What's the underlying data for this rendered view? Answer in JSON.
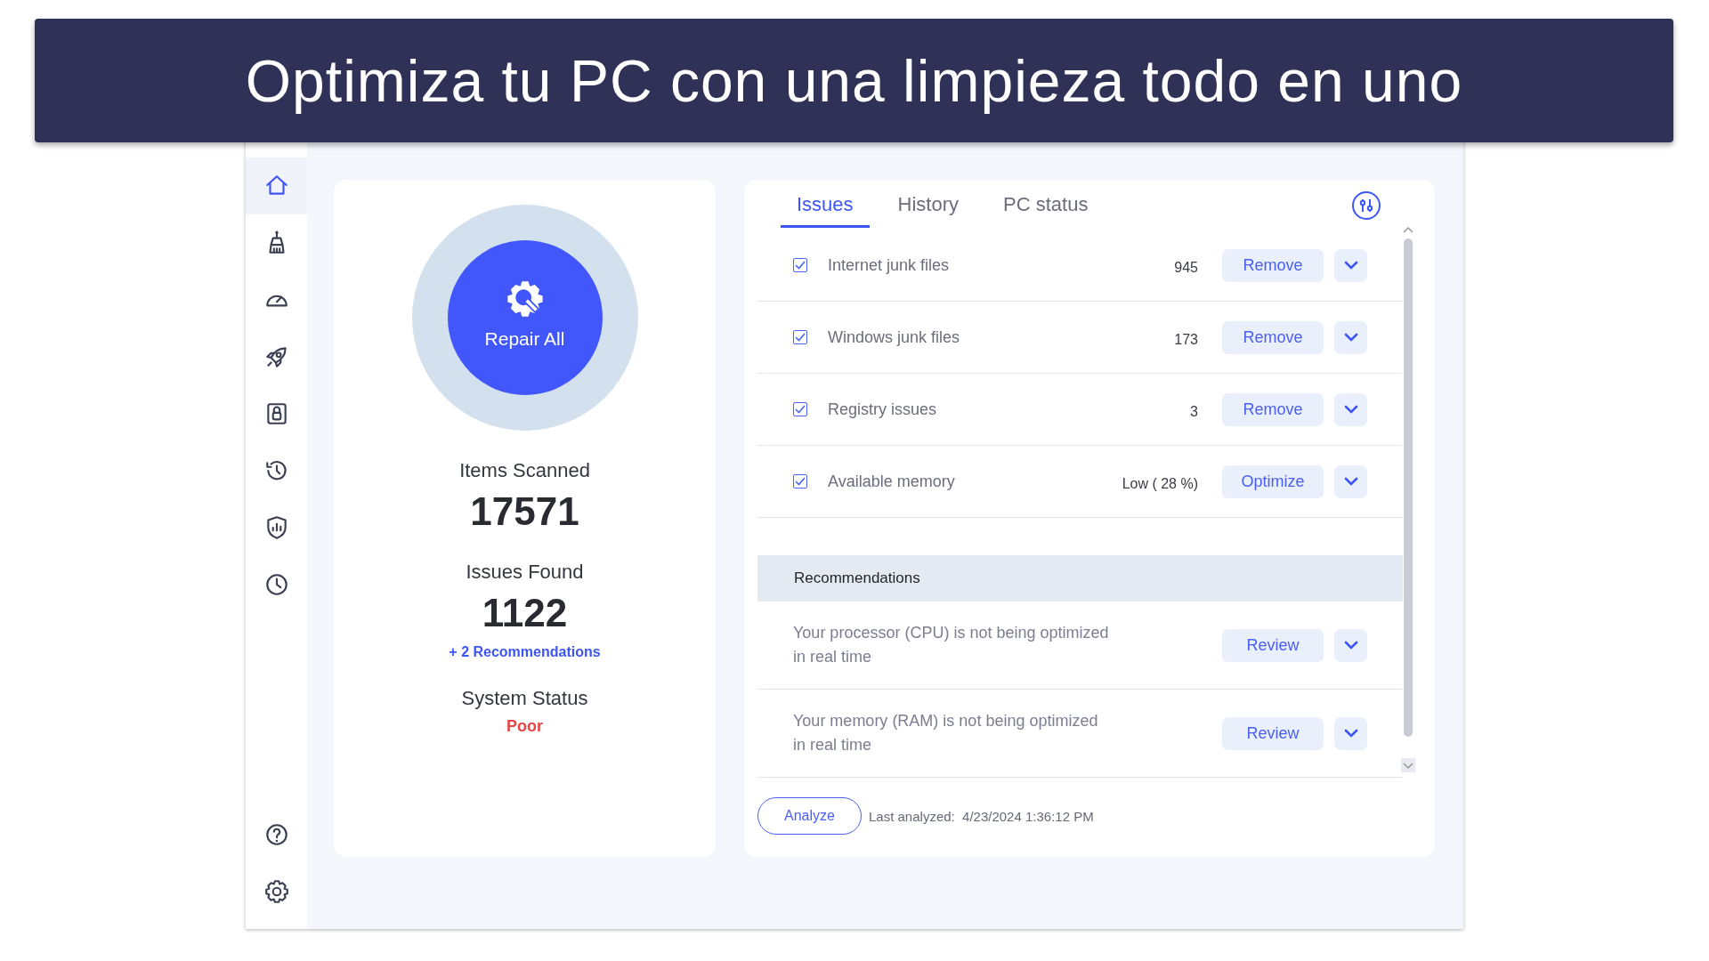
{
  "banner": {
    "title": "Optimiza tu PC con una limpieza todo en uno"
  },
  "sidebar": {
    "items": [
      {
        "selected": true
      },
      {
        "selected": false
      },
      {
        "selected": false
      },
      {
        "selected": false
      },
      {
        "selected": false
      },
      {
        "selected": false
      },
      {
        "selected": false
      },
      {
        "selected": false
      }
    ],
    "bottom_items": [
      {
        "selected": false
      },
      {
        "selected": false
      }
    ]
  },
  "summary": {
    "repair_button": "Repair All",
    "items_label": "Items Scanned",
    "items_value": "17571",
    "issues_label": "Issues Found",
    "issues_value": "1122",
    "recommendations_link": "+ 2 Recommendations",
    "status_label": "System Status",
    "status_value": "Poor"
  },
  "tabs": [
    {
      "label": "Issues",
      "selected": true
    },
    {
      "label": "History",
      "selected": false
    },
    {
      "label": "PC status",
      "selected": false
    }
  ],
  "issues": [
    {
      "label": "Internet junk files",
      "checked": true,
      "count": "945",
      "action": "Remove"
    },
    {
      "label": "Windows junk files",
      "checked": true,
      "count": "173",
      "action": "Remove"
    },
    {
      "label": "Registry issues",
      "checked": true,
      "count": "3",
      "action": "Remove"
    },
    {
      "label": "Available memory",
      "checked": true,
      "count": "Low ( 28 %)",
      "action": "Optimize"
    }
  ],
  "recommendations": {
    "title": "Recommendations",
    "items": [
      {
        "text": "Your processor (CPU) is not being optimized in real time",
        "action": "Review"
      },
      {
        "text": "Your memory (RAM) is not being optimized in real time",
        "action": "Review"
      }
    ]
  },
  "footer": {
    "analyze_button": "Analyze",
    "last_analyzed": "Last analyzed:  4/23/2024 1:36:12 PM"
  }
}
